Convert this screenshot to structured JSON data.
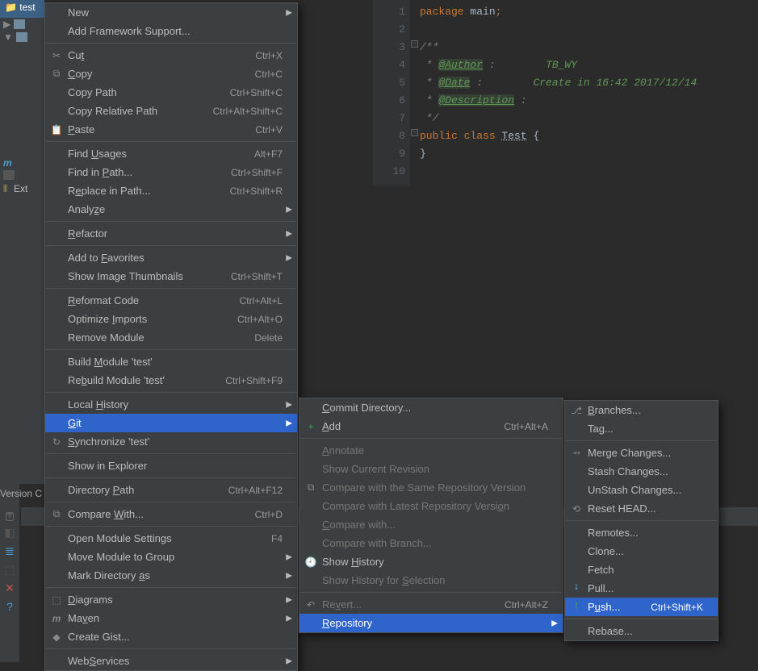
{
  "project": {
    "header": "test",
    "ext_lib": "Ext"
  },
  "version_label": "Version C",
  "editor": {
    "gutter": [
      "1",
      "2",
      "3",
      "4",
      "5",
      "6",
      "7",
      "8",
      "9",
      "10"
    ],
    "lines": {
      "l1_kw": "package",
      "l1_name": " main",
      "l3": "/**",
      "l4_pre": " * ",
      "l4_tag": "@Author",
      "l4_col": " :        ",
      "l4_val": "TB_WY",
      "l5_pre": " * ",
      "l5_tag": "@Date",
      "l5_col": " :        ",
      "l5_val": "Create in 16:42 2017/12/14",
      "l6_pre": " * ",
      "l6_tag": "@Description",
      "l6_col": " :",
      "l7": " */",
      "l8_pub": "public ",
      "l8_cls": "class ",
      "l8_name": "Test",
      "l8_br": " {",
      "l9": "}"
    }
  },
  "menu1": [
    {
      "type": "item",
      "label": "New",
      "arrow": true
    },
    {
      "type": "item",
      "label": "Add Framework Support..."
    },
    {
      "type": "sep"
    },
    {
      "type": "item",
      "icon": "✂",
      "label": "Cut",
      "u": 2,
      "shortcut": "Ctrl+X"
    },
    {
      "type": "item",
      "icon": "⧉",
      "label": "Copy",
      "u": 0,
      "shortcut": "Ctrl+C"
    },
    {
      "type": "item",
      "label": "Copy Path",
      "shortcut": "Ctrl+Shift+C"
    },
    {
      "type": "item",
      "label": "Copy Relative Path",
      "shortcut": "Ctrl+Alt+Shift+C"
    },
    {
      "type": "item",
      "icon": "📋",
      "label": "Paste",
      "u": 0,
      "shortcut": "Ctrl+V"
    },
    {
      "type": "sep"
    },
    {
      "type": "item",
      "label": "Find Usages",
      "u": 5,
      "shortcut": "Alt+F7"
    },
    {
      "type": "item",
      "label": "Find in Path...",
      "u": 8,
      "shortcut": "Ctrl+Shift+F"
    },
    {
      "type": "item",
      "label": "Replace in Path...",
      "u": 1,
      "shortcut": "Ctrl+Shift+R"
    },
    {
      "type": "item",
      "label": "Analyze",
      "u": 5,
      "arrow": true
    },
    {
      "type": "sep"
    },
    {
      "type": "item",
      "label": "Refactor",
      "u": 0,
      "arrow": true
    },
    {
      "type": "sep"
    },
    {
      "type": "item",
      "label": "Add to Favorites",
      "u": 7,
      "arrow": true
    },
    {
      "type": "item",
      "label": "Show Image Thumbnails",
      "shortcut": "Ctrl+Shift+T"
    },
    {
      "type": "sep"
    },
    {
      "type": "item",
      "label": "Reformat Code",
      "u": 0,
      "shortcut": "Ctrl+Alt+L"
    },
    {
      "type": "item",
      "label": "Optimize Imports",
      "u": 9,
      "shortcut": "Ctrl+Alt+O"
    },
    {
      "type": "item",
      "label": "Remove Module",
      "shortcut": "Delete"
    },
    {
      "type": "sep"
    },
    {
      "type": "item",
      "label": "Build Module 'test'",
      "u": 6
    },
    {
      "type": "item",
      "label": "Rebuild Module 'test'",
      "u": 2,
      "shortcut": "Ctrl+Shift+F9"
    },
    {
      "type": "sep"
    },
    {
      "type": "item",
      "label": "Local History",
      "u": 6,
      "arrow": true
    },
    {
      "type": "item",
      "label": "Git",
      "u": 0,
      "arrow": true,
      "selected": true
    },
    {
      "type": "item",
      "icon": "↻",
      "label": "Synchronize 'test'",
      "u": 0
    },
    {
      "type": "sep"
    },
    {
      "type": "item",
      "label": "Show in Explorer"
    },
    {
      "type": "sep"
    },
    {
      "type": "item",
      "label": "Directory Path",
      "u": 10,
      "shortcut": "Ctrl+Alt+F12"
    },
    {
      "type": "sep"
    },
    {
      "type": "item",
      "icon": "⧉",
      "label": "Compare With...",
      "u": 8,
      "shortcut": "Ctrl+D"
    },
    {
      "type": "sep"
    },
    {
      "type": "item",
      "label": "Open Module Settings",
      "shortcut": "F4"
    },
    {
      "type": "item",
      "label": "Move Module to Group",
      "arrow": true
    },
    {
      "type": "item",
      "label": "Mark Directory as",
      "u": 15,
      "arrow": true
    },
    {
      "type": "sep"
    },
    {
      "type": "item",
      "icon": "⬚",
      "label": "Diagrams",
      "u": 0,
      "arrow": true
    },
    {
      "type": "item",
      "iconhtml": "m",
      "iconcls": "m-icon",
      "label": "Maven",
      "u": 2,
      "arrow": true
    },
    {
      "type": "item",
      "icon": "◆",
      "label": "Create Gist..."
    },
    {
      "type": "sep"
    },
    {
      "type": "item",
      "label": "WebServices",
      "u": 3,
      "arrow": true
    }
  ],
  "menu2": [
    {
      "type": "item",
      "label": "Commit Directory...",
      "u": 0
    },
    {
      "type": "item",
      "icon": "+",
      "iconcolor": "#499c54",
      "label": "Add",
      "u": 0,
      "shortcut": "Ctrl+Alt+A"
    },
    {
      "type": "sep"
    },
    {
      "type": "item",
      "label": "Annotate",
      "u": 0,
      "disabled": true
    },
    {
      "type": "item",
      "label": "Show Current Revision",
      "disabled": true
    },
    {
      "type": "item",
      "icon": "⧉",
      "label": "Compare with the Same Repository Version",
      "disabled": true
    },
    {
      "type": "item",
      "label": "Compare with Latest Repository Version",
      "u": 36,
      "disabled": true
    },
    {
      "type": "item",
      "label": "Compare with...",
      "u": 0,
      "disabled": true
    },
    {
      "type": "item",
      "label": "Compare with Branch...",
      "disabled": true
    },
    {
      "type": "item",
      "icon": "🕘",
      "label": "Show History",
      "u": 5
    },
    {
      "type": "item",
      "label": "Show History for Selection",
      "u": 17,
      "disabled": true
    },
    {
      "type": "sep"
    },
    {
      "type": "item",
      "icon": "↶",
      "label": "Revert...",
      "u": 2,
      "disabled": true,
      "shortcut": "Ctrl+Alt+Z"
    },
    {
      "type": "item",
      "label": "Repository",
      "u": 0,
      "arrow": true,
      "selected": true
    }
  ],
  "menu3": [
    {
      "type": "item",
      "icon": "⎇",
      "label": "Branches...",
      "u": 0
    },
    {
      "type": "item",
      "label": "Tag..."
    },
    {
      "type": "sep"
    },
    {
      "type": "item",
      "icon": "⥇",
      "label": "Merge Changes..."
    },
    {
      "type": "item",
      "label": "Stash Changes..."
    },
    {
      "type": "item",
      "label": "UnStash Changes..."
    },
    {
      "type": "item",
      "icon": "⟲",
      "label": "Reset HEAD..."
    },
    {
      "type": "sep"
    },
    {
      "type": "item",
      "label": "Remotes..."
    },
    {
      "type": "item",
      "label": "Clone..."
    },
    {
      "type": "item",
      "label": "Fetch"
    },
    {
      "type": "item",
      "icon": "⭭",
      "iconcolor": "#4e9fd6",
      "label": "Pull..."
    },
    {
      "type": "item",
      "icon": "⭫",
      "iconcolor": "#499c54",
      "label": "Push...",
      "u": 1,
      "shortcut": "Ctrl+Shift+K",
      "selected": true
    },
    {
      "type": "sep"
    },
    {
      "type": "item",
      "label": "Rebase..."
    }
  ]
}
